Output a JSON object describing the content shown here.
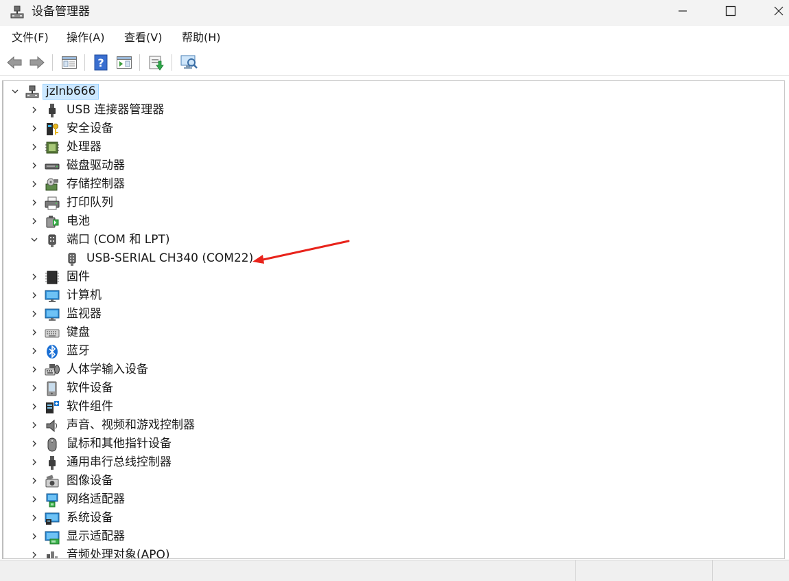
{
  "window": {
    "title": "设备管理器"
  },
  "menu": [
    {
      "label": "文件(F)"
    },
    {
      "label": "操作(A)"
    },
    {
      "label": "查看(V)"
    },
    {
      "label": "帮助(H)"
    }
  ],
  "toolbar": [
    {
      "icon": "back-arrow-icon"
    },
    {
      "icon": "forward-arrow-icon"
    },
    {
      "icon": "properties-pane-icon"
    },
    {
      "icon": "help-icon"
    },
    {
      "icon": "action-pane-icon"
    },
    {
      "icon": "update-driver-icon"
    },
    {
      "icon": "scan-hardware-icon"
    }
  ],
  "tree": {
    "root": {
      "label": "jzlnb666",
      "icon": "computer-network-icon"
    },
    "items": [
      {
        "label": "USB 连接器管理器",
        "icon": "usb-plug-icon"
      },
      {
        "label": "安全设备",
        "icon": "security-key-icon"
      },
      {
        "label": "处理器",
        "icon": "cpu-chip-icon"
      },
      {
        "label": "磁盘驱动器",
        "icon": "disk-drive-icon"
      },
      {
        "label": "存储控制器",
        "icon": "storage-controller-icon"
      },
      {
        "label": "打印队列",
        "icon": "printer-icon"
      },
      {
        "label": "电池",
        "icon": "battery-icon"
      },
      {
        "label": "端口 (COM 和 LPT)",
        "icon": "port-connector-icon",
        "expanded": true
      },
      {
        "label": "USB-SERIAL CH340 (COM22)",
        "icon": "serial-port-icon",
        "child": true
      },
      {
        "label": "固件",
        "icon": "firmware-chip-icon"
      },
      {
        "label": "计算机",
        "icon": "monitor-icon"
      },
      {
        "label": "监视器",
        "icon": "monitor-icon"
      },
      {
        "label": "键盘",
        "icon": "keyboard-icon"
      },
      {
        "label": "蓝牙",
        "icon": "bluetooth-icon"
      },
      {
        "label": "人体学输入设备",
        "icon": "hid-icon"
      },
      {
        "label": "软件设备",
        "icon": "software-device-icon"
      },
      {
        "label": "软件组件",
        "icon": "software-component-icon"
      },
      {
        "label": "声音、视频和游戏控制器",
        "icon": "speaker-icon"
      },
      {
        "label": "鼠标和其他指针设备",
        "icon": "mouse-icon"
      },
      {
        "label": "通用串行总线控制器",
        "icon": "usb-plug-icon"
      },
      {
        "label": "图像设备",
        "icon": "camera-icon"
      },
      {
        "label": "网络适配器",
        "icon": "network-adapter-icon"
      },
      {
        "label": "系统设备",
        "icon": "system-device-icon"
      },
      {
        "label": "显示适配器",
        "icon": "display-adapter-icon"
      },
      {
        "label": "音频处理对象(APO)",
        "icon": "audio-apo-icon"
      }
    ]
  },
  "colors": {
    "annotation_arrow": "#e8231b",
    "selection": "#cce8ff"
  }
}
